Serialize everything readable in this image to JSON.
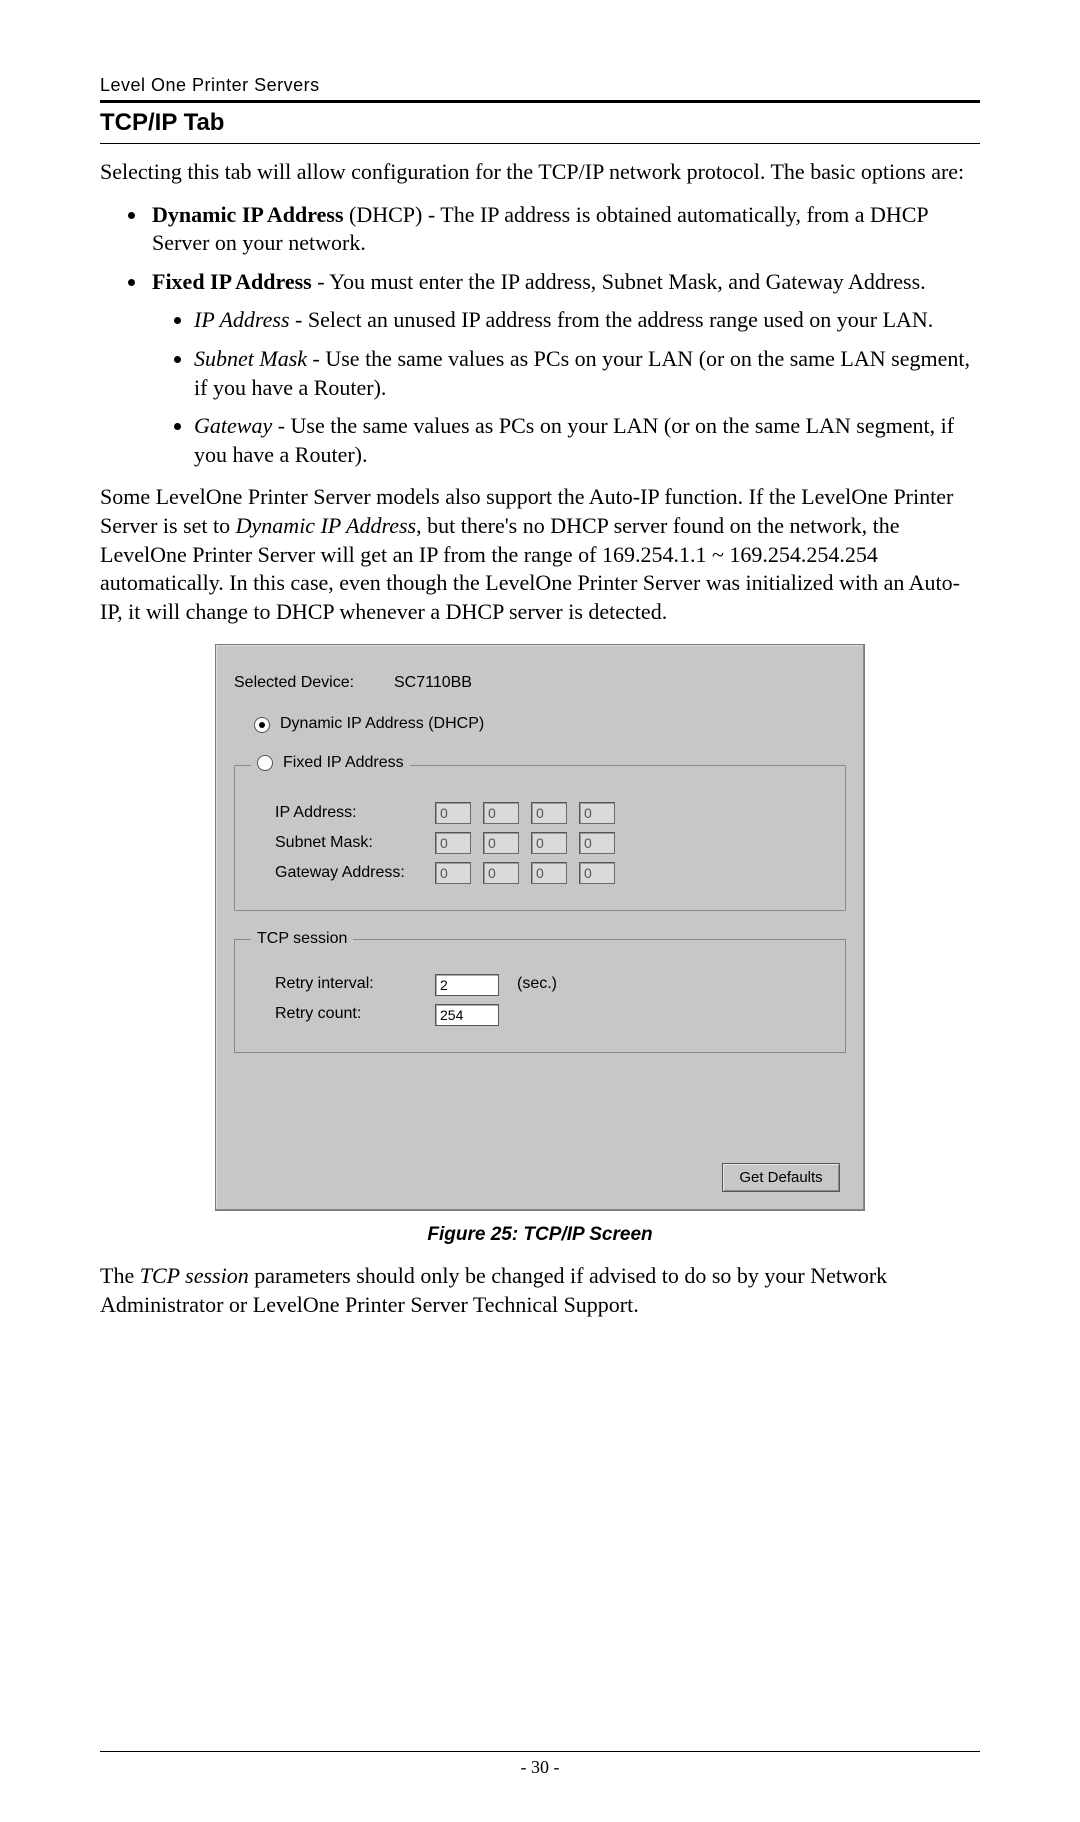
{
  "header": {
    "running": "Level One Printer Servers",
    "section": "TCP/IP Tab"
  },
  "intro": "Selecting this tab will allow configuration for the TCP/IP network protocol. The basic options are:",
  "items": {
    "dhcp": {
      "term": "Dynamic IP Address",
      "paren": " (DHCP) - ",
      "desc": "The IP address is obtained automatically, from a DHCP Server on your network."
    },
    "fixed": {
      "term": "Fixed IP Address",
      "sep": " - ",
      "desc": "You must enter the IP address, Subnet Mask, and Gateway Address.",
      "ip": {
        "term": "IP Address",
        "sep": " - ",
        "desc": "Select an unused IP address from the address range used on your LAN."
      },
      "subnet": {
        "term": "Subnet Mask",
        "sep": " - ",
        "desc": "Use the same values as PCs on your LAN (or on the same LAN segment, if you have a Router)."
      },
      "gateway": {
        "term": "Gateway",
        "sep": " - ",
        "desc": "Use the same values as PCs on your LAN (or on the same LAN segment, if you have a Router)."
      }
    }
  },
  "autoip": {
    "pre": "Some LevelOne Printer Server models also support the Auto-IP function. If the LevelOne Printer Server is set to ",
    "em": "Dynamic IP Address",
    "post": ", but there's no DHCP server found on the network, the LevelOne Printer Server will get an IP from the range of 169.254.1.1 ~ 169.254.254.254 automatically. In this case, even though the LevelOne Printer Server was initialized with an Auto-IP, it will change to DHCP whenever a DHCP server is detected."
  },
  "screenshot": {
    "selected_label": "Selected Device:",
    "selected_value": "SC7110BB",
    "radio_dynamic": "Dynamic IP Address (DHCP)",
    "radio_fixed": "Fixed IP Address",
    "ip_label": "IP Address:",
    "subnet_label": "Subnet Mask:",
    "gateway_label": "Gateway Address:",
    "octet": "0",
    "tcp_legend": "TCP session",
    "retry_interval_label": "Retry interval:",
    "retry_interval_value": "2",
    "retry_interval_unit": "(sec.)",
    "retry_count_label": "Retry count:",
    "retry_count_value": "254",
    "get_defaults": "Get Defaults"
  },
  "figcaption": "Figure 25: TCP/IP Screen",
  "closing": {
    "pre": "The ",
    "em": "TCP session",
    "post": " parameters should only be changed if advised to do so by your Network Administrator or LevelOne Printer Server Technical Support."
  },
  "page_number": "- 30 -"
}
